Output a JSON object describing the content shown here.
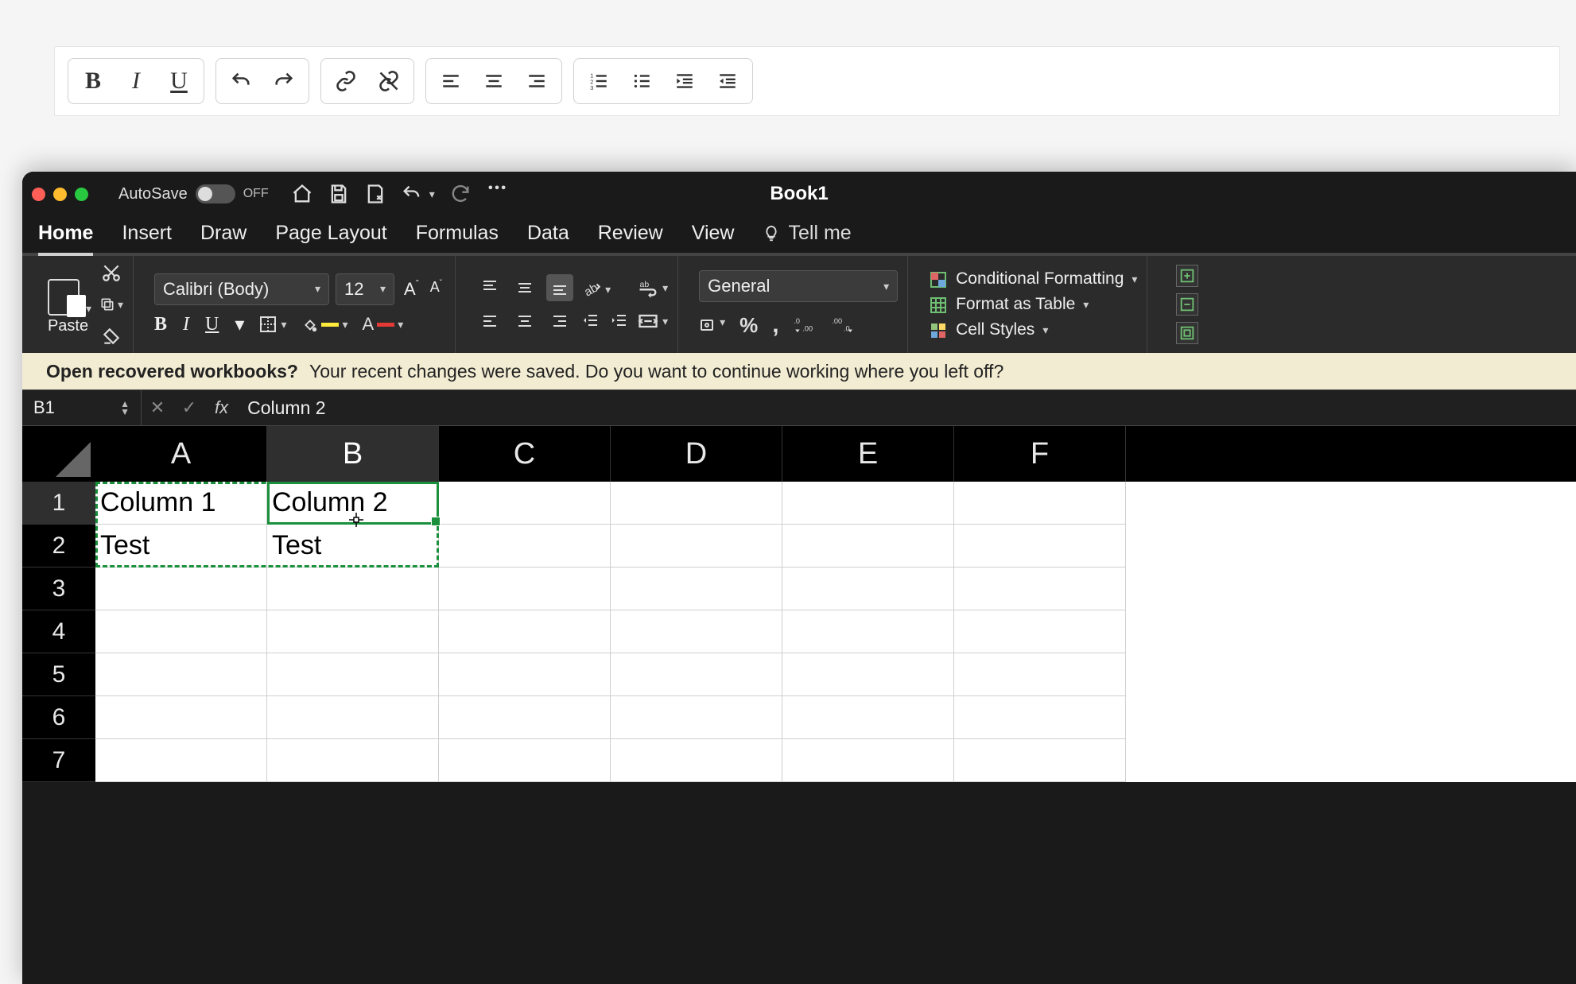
{
  "doc_toolbar": {
    "bold": "B",
    "italic": "I",
    "underline": "U"
  },
  "titlebar": {
    "autosave_label": "AutoSave",
    "autosave_state": "OFF",
    "title": "Book1"
  },
  "tabs": {
    "home": "Home",
    "insert": "Insert",
    "draw": "Draw",
    "page_layout": "Page Layout",
    "formulas": "Formulas",
    "data": "Data",
    "review": "Review",
    "view": "View",
    "tell_me": "Tell me"
  },
  "ribbon": {
    "paste": "Paste",
    "font_name": "Calibri (Body)",
    "font_size": "12",
    "number_format": "General",
    "cond_fmt": "Conditional Formatting",
    "table_fmt": "Format as Table",
    "cell_styles": "Cell Styles",
    "bold": "B",
    "italic": "I",
    "underline": "U",
    "font_A": "A"
  },
  "banner": {
    "question": "Open recovered workbooks?",
    "message": "Your recent changes were saved. Do you want to continue working where you left off?"
  },
  "formula_bar": {
    "name_box": "B1",
    "fx": "fx",
    "value": "Column 2"
  },
  "grid": {
    "columns": [
      "A",
      "B",
      "C",
      "D",
      "E",
      "F"
    ],
    "rows": [
      "1",
      "2",
      "3",
      "4",
      "5",
      "6",
      "7"
    ],
    "cells": {
      "A1": "Column 1",
      "B1": "Column 2",
      "A2": "Test",
      "B2": "Test"
    },
    "selected_column": "B",
    "selected_row": "1",
    "copied_range": "A1:B2",
    "active_cell": "B1"
  }
}
